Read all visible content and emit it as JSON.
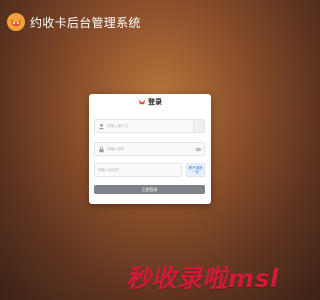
{
  "brand": {
    "title": "约收卡后台管理系统",
    "logo": "fox-logo-icon"
  },
  "login": {
    "title": "登录",
    "username_placeholder": "请输入用户名",
    "password_placeholder": "请输入密码",
    "captcha_placeholder": "请输入验证码",
    "captcha_image_text": "看不清换一张",
    "submit_label": "立即登录"
  },
  "watermark": {
    "text": "秒收录啦msl"
  },
  "colors": {
    "background": "#8a4e2a",
    "button": "#7d8288",
    "link": "#3b7ad8",
    "watermark": "#cf1a3a"
  }
}
